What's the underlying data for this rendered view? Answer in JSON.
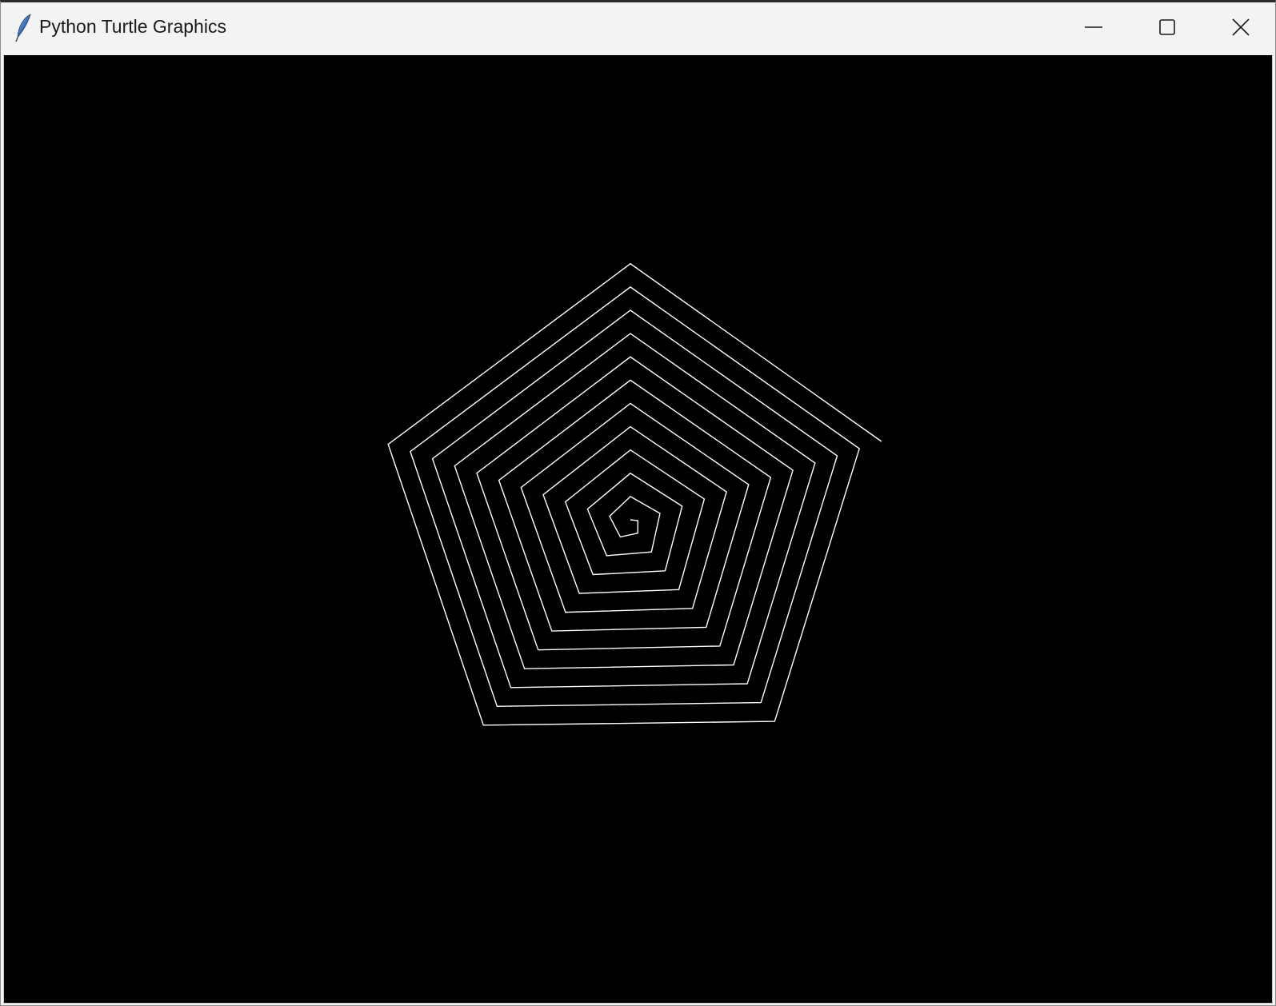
{
  "window": {
    "title": "Python Turtle Graphics",
    "icon": "feather-icon",
    "controls": {
      "minimize": "minimize-icon",
      "maximize": "maximize-icon",
      "close": "close-icon"
    }
  },
  "canvas": {
    "background_color": "#000000",
    "pen_color": "#ffffff",
    "drawing": {
      "shape": "pentagon-spiral",
      "sides_per_turn": 5,
      "turn_angle_deg": 72
    }
  }
}
